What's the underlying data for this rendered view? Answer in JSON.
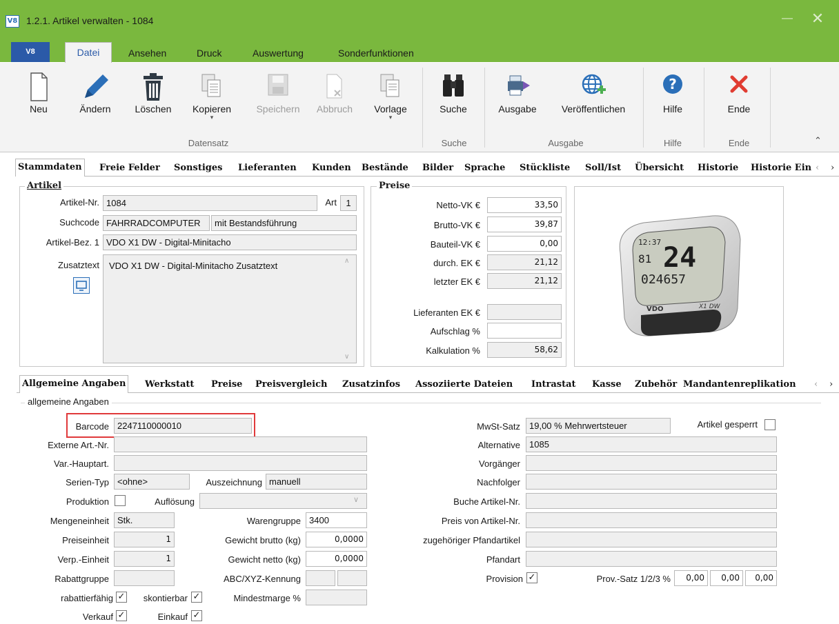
{
  "window": {
    "app_icon": "V8",
    "title": "1.2.1. Artikel verwalten - 1084",
    "minimize": "—",
    "close": "✕"
  },
  "menu": {
    "app_label": "V8",
    "items": [
      "Datei",
      "Ansehen",
      "Druck",
      "Auswertung",
      "Sonderfunktionen"
    ]
  },
  "ribbon": {
    "buttons": {
      "neu": "Neu",
      "aendern": "Ändern",
      "loeschen": "Löschen",
      "kopieren": "Kopieren",
      "speichern": "Speichern",
      "abbruch": "Abbruch",
      "vorlage": "Vorlage",
      "suche": "Suche",
      "ausgabe": "Ausgabe",
      "veroeffentlichen": "Veröffentlichen",
      "hilfe": "Hilfe",
      "ende": "Ende"
    },
    "groups": {
      "datensatz": "Datensatz",
      "suche": "Suche",
      "ausgabe": "Ausgabe",
      "hilfe": "Hilfe",
      "ende": "Ende"
    }
  },
  "top_tabs": [
    "Stammdaten",
    "Freie Felder",
    "Sonstiges",
    "Lieferanten",
    "Kunden",
    "Bestände",
    "Bilder",
    "Sprache",
    "Stückliste",
    "Soll/Ist",
    "Übersicht",
    "Historie",
    "Historie Ein"
  ],
  "artikel": {
    "title": "Artikel",
    "nr_label": "Artikel-Nr.",
    "nr_value": "1084",
    "art_label": "Art",
    "art_value": "1",
    "suchcode_label": "Suchcode",
    "suchcode_value": "FAHRRADCOMPUTER",
    "bestand_value": "mit Bestandsführung",
    "bez_label": "Artikel-Bez. 1",
    "bez_value": "VDO X1 DW - Digital-Minitacho",
    "zusatz_label": "Zusatztext",
    "zusatz_value": "VDO X1 DW - Digital-Minitacho Zusatztext"
  },
  "preise": {
    "title": "Preise",
    "rows": [
      {
        "label": "Netto-VK €",
        "value": "33,50"
      },
      {
        "label": "Brutto-VK €",
        "value": "39,87"
      },
      {
        "label": "Bauteil-VK €",
        "value": "0,00"
      },
      {
        "label": "durch. EK €",
        "value": "21,12"
      },
      {
        "label": "letzter EK €",
        "value": "21,12"
      },
      {
        "label": "Lieferanten EK €",
        "value": ""
      },
      {
        "label": "Aufschlag %",
        "value": ""
      },
      {
        "label": "Kalkulation %",
        "value": "58,62"
      }
    ]
  },
  "device_display": {
    "line1": "12:37",
    "line2": "24",
    "line3": "81",
    "line4": "024657",
    "brand": "VDO",
    "model": "X1 DW"
  },
  "bottom_tabs": [
    "Allgemeine Angaben",
    "Werkstatt",
    "Preise",
    "Preisvergleich",
    "Zusatzinfos",
    "Assoziierte Dateien",
    "Intrastat",
    "Kasse",
    "Zubehör",
    "Mandantenreplikation"
  ],
  "allgemein": {
    "group_title": "allgemeine Angaben",
    "barcode_label": "Barcode",
    "barcode_value": "2247110000010",
    "extern_label": "Externe Art.-Nr.",
    "varhaupt_label": "Var.-Hauptart.",
    "serien_label": "Serien-Typ",
    "serien_value": "<ohne>",
    "auszeichnung_label": "Auszeichnung",
    "auszeichnung_value": "manuell",
    "produktion_label": "Produktion",
    "aufloesung_label": "Auflösung",
    "mengeneinheit_label": "Mengeneinheit",
    "mengeneinheit_value": "Stk.",
    "warengruppe_label": "Warengruppe",
    "warengruppe_value": "3400",
    "preiseinheit_label": "Preiseinheit",
    "preiseinheit_value": "1",
    "gewicht_brutto_label": "Gewicht brutto (kg)",
    "gewicht_brutto_value": "0,0000",
    "verp_label": "Verp.-Einheit",
    "verp_value": "1",
    "gewicht_netto_label": "Gewicht netto (kg)",
    "gewicht_netto_value": "0,0000",
    "rabattgruppe_label": "Rabattgruppe",
    "abc_label": "ABC/XYZ-Kennung",
    "rabattfaehig_label": "rabattierfähig",
    "skontierbar_label": "skontierbar",
    "mindestmarge_label": "Mindestmarge %",
    "verkauf_label": "Verkauf",
    "einkauf_label": "Einkauf",
    "mwst_label": "MwSt-Satz",
    "mwst_value": "19,00 % Mehrwertsteuer",
    "gesperrt_label": "Artikel gesperrt",
    "alternative_label": "Alternative",
    "alternative_value": "1085",
    "vorgaenger_label": "Vorgänger",
    "nachfolger_label": "Nachfolger",
    "buche_label": "Buche Artikel-Nr.",
    "preisvon_label": "Preis von Artikel-Nr.",
    "pfandartikel_label": "zugehöriger Pfandartikel",
    "pfandart_label": "Pfandart",
    "provision_label": "Provision",
    "provsatz_label": "Prov.-Satz 1/2/3 %",
    "provsatz_values": [
      "0,00",
      "0,00",
      "0,00"
    ]
  },
  "check": "✓",
  "colors": {
    "accent_green": "#7ab83e",
    "highlight_red": "#e0393a",
    "brand_blue": "#2b5aa8"
  }
}
